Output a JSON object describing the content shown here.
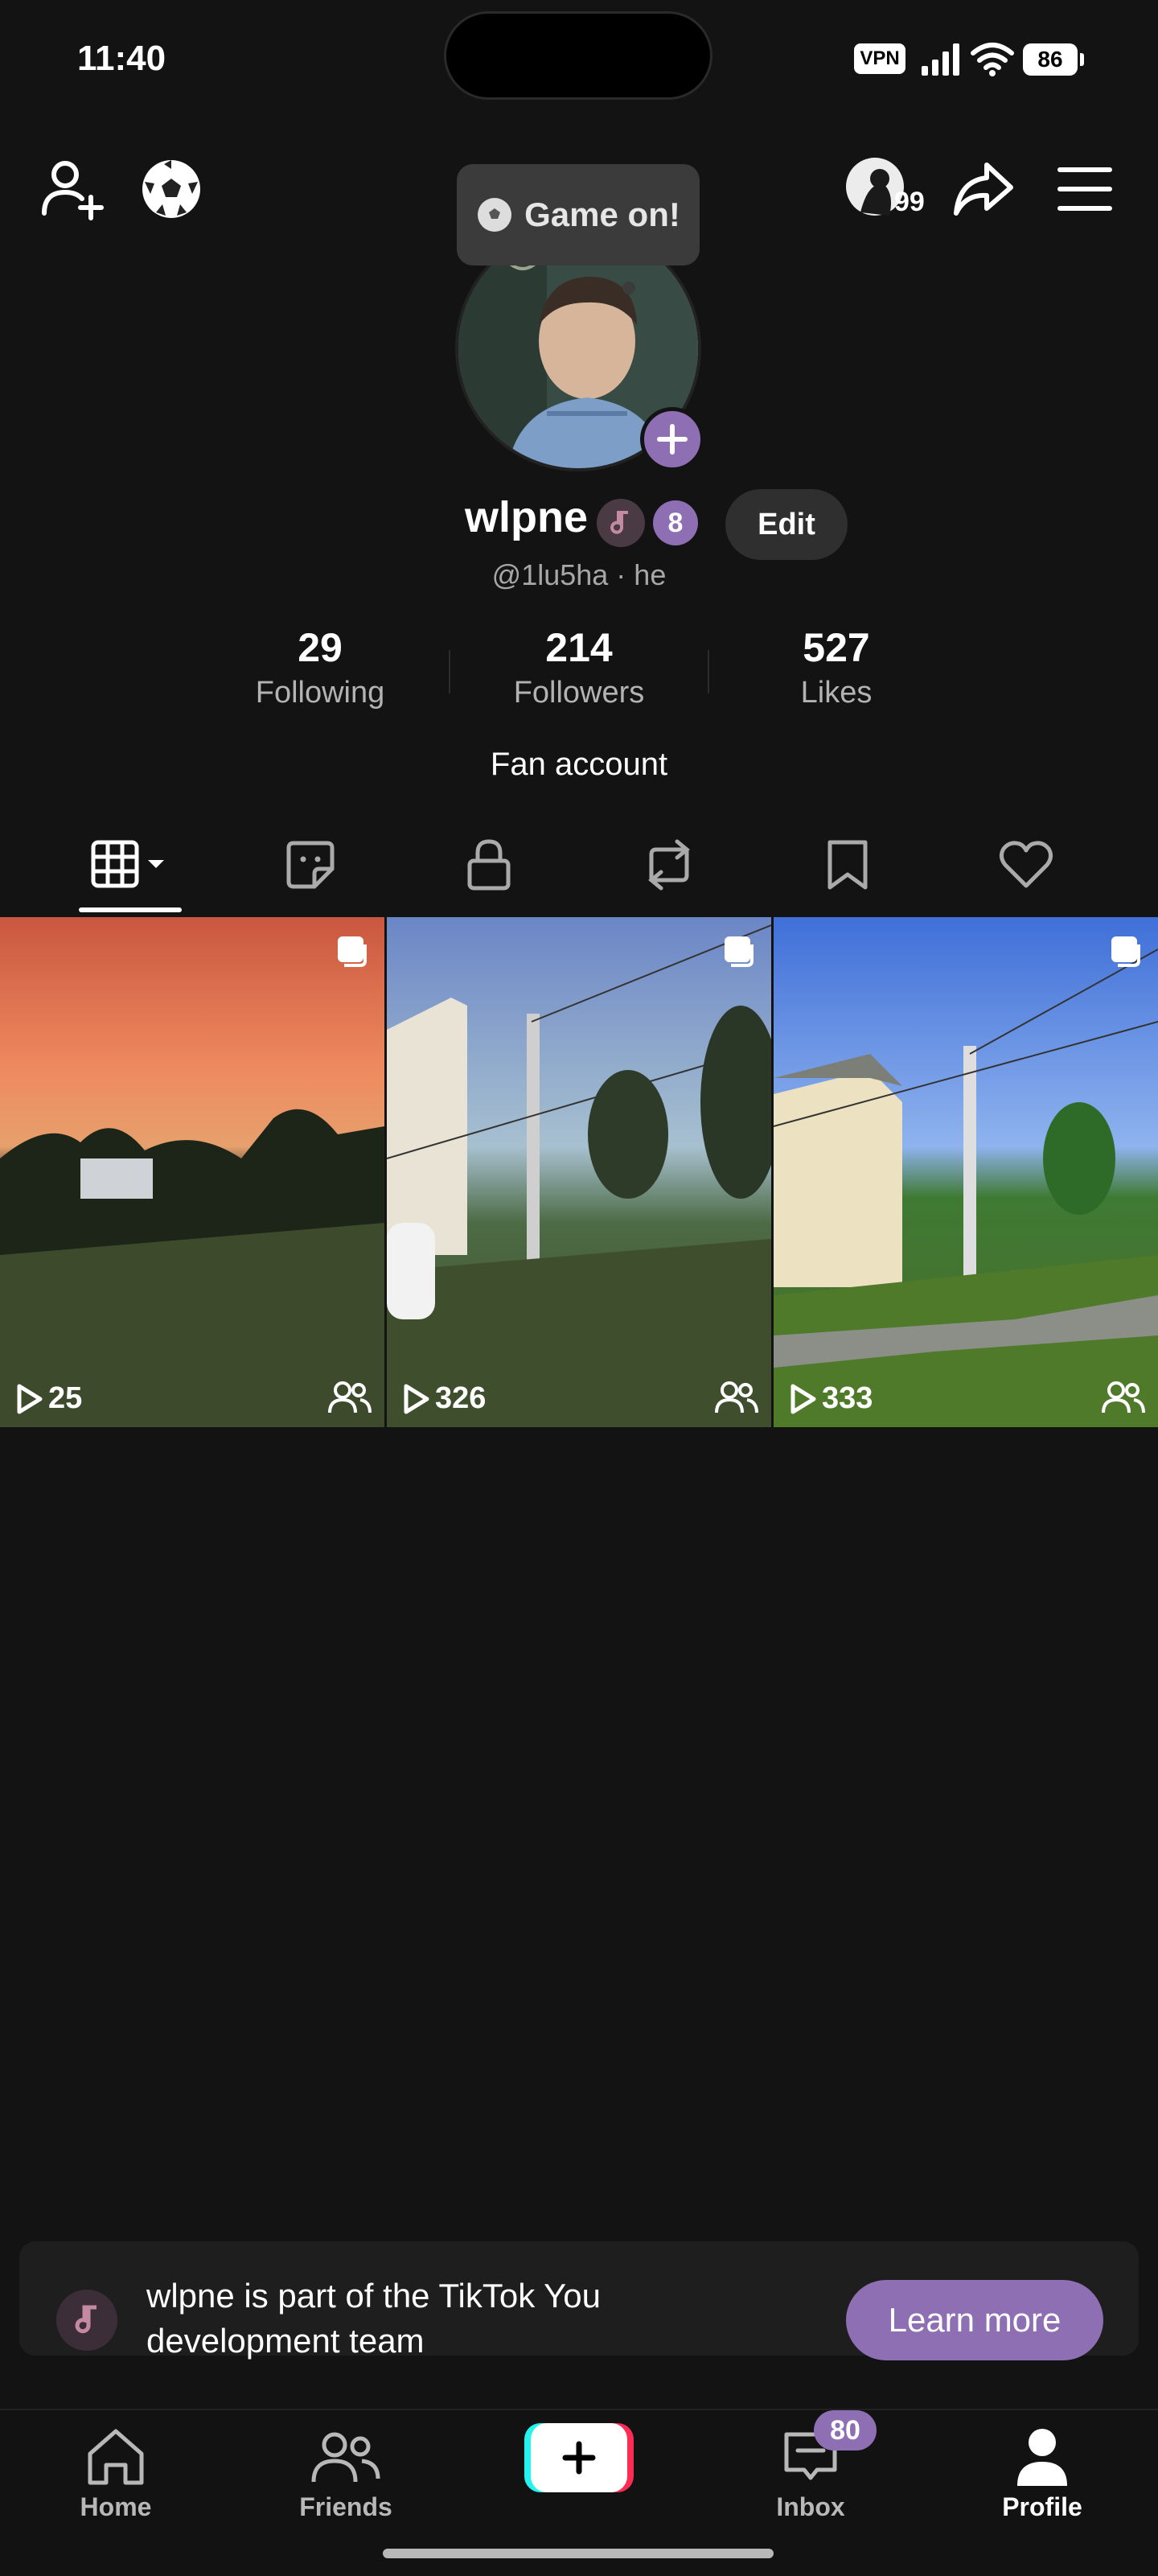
{
  "status": {
    "time": "11:40",
    "vpn": "VPN",
    "battery": "86"
  },
  "header": {
    "avatar_badge": "99",
    "status_bubble": "Game on!"
  },
  "profile": {
    "display_name": "wlpne",
    "level": "8",
    "edit_label": "Edit",
    "handle": "@1lu5ha · he",
    "stats": [
      {
        "value": "29",
        "label": "Following"
      },
      {
        "value": "214",
        "label": "Followers"
      },
      {
        "value": "527",
        "label": "Likes"
      }
    ],
    "bio": "Fan account"
  },
  "tabs": [
    "videos-grid",
    "stickers",
    "private",
    "reposts",
    "favorites",
    "liked"
  ],
  "videos": [
    {
      "views": "25",
      "scene": "sunset garden"
    },
    {
      "views": "326",
      "scene": "misty street"
    },
    {
      "views": "333",
      "scene": "sunny yard"
    }
  ],
  "banner": {
    "text": "wlpne is part of the TikTok You development team",
    "button": "Learn more"
  },
  "nav": {
    "home": "Home",
    "friends": "Friends",
    "inbox": "Inbox",
    "inbox_count": "80",
    "profile": "Profile"
  },
  "colors": {
    "accent": "#8e6fb3",
    "background": "#131313"
  }
}
